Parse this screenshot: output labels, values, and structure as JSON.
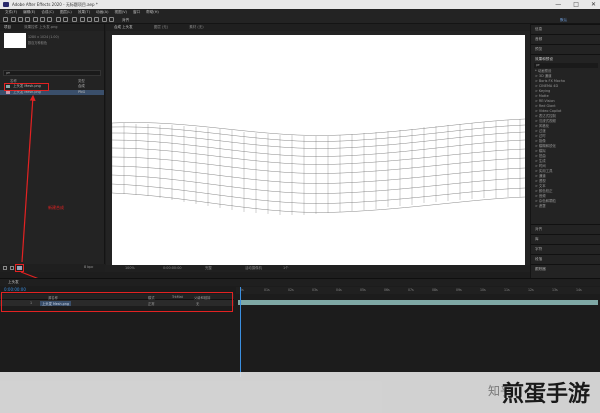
{
  "window": {
    "title": "Adobe After Effects 2020 - 无标题项目.aep *",
    "controls": [
      "—",
      "□",
      "✕"
    ]
  },
  "menu": [
    "文件(F)",
    "编辑(E)",
    "合成(C)",
    "图层(L)",
    "效果(T)",
    "动画(A)",
    "视图(V)",
    "窗口",
    "帮助(H)"
  ],
  "toolbar": {
    "icons": [
      "home-icon",
      "selection-icon",
      "hand-icon",
      "zoom-icon",
      "rotate-icon",
      "camera-icon",
      "pan-behind-icon",
      "rectangle-icon",
      "pen-icon",
      "text-icon",
      "brush-icon",
      "clone-icon",
      "eraser-icon",
      "roto-icon",
      "puppet-icon"
    ],
    "right_label": "对齐",
    "workspace": "默认"
  },
  "project": {
    "tab": "项目",
    "tab2": "效果控件 上头发.png",
    "info_line1": "1280 x 1024 (1.00)",
    "info_line2": "数百万种颜色",
    "search_placeholder": "ρ▾",
    "col_name": "名称",
    "col_type": "类型",
    "items": [
      {
        "name": "上头发 Mesh.png",
        "type": "合成"
      },
      {
        "name": "上头发 Mesh.png",
        "type": "PNG"
      }
    ],
    "bit_depth": "8 bpc"
  },
  "viewer": {
    "tab1": "合成 上头发",
    "tab2": "图层 (无)",
    "tab3": "素材 (无)",
    "zoom": "100%",
    "timecode": "0:00:00:00",
    "resolution": "完整",
    "camera": "活动摄像机",
    "views": "1个"
  },
  "annotation": {
    "text": "新建合成"
  },
  "rightpanel": {
    "sections": [
      "信息",
      "音频",
      "预览",
      "效果和预设"
    ],
    "search": "ρ▾",
    "presets": [
      "* 动画预设",
      "> 3D 通道",
      "> Boris FX Mocha",
      "> CINEMA 4D",
      "> Keying",
      "> Matte",
      "> RE:Vision",
      "> Red Giant",
      "> Video Copilot",
      "> 表达式控制",
      "> 沉浸式视频",
      "> 风格化",
      "> 过渡",
      "> 过时",
      "> 抠像",
      "> 模糊和锐化",
      "> 模拟",
      "> 扭曲",
      "> 生成",
      "> 时间",
      "> 实用工具",
      "> 通道",
      "> 透视",
      "> 文本",
      "> 颜色校正",
      "> 音频",
      "> 杂色和颗粒",
      "> 遮罩"
    ],
    "bottom_sections": [
      "对齐",
      "库",
      "字符",
      "段落",
      "跟踪器"
    ]
  },
  "timeline": {
    "tab": "上头发",
    "timecode": "0:00:00:00",
    "col_source": "源名称",
    "col_mode": "模式",
    "col_trkmat": "TrkMat",
    "col_parent": "父级和链接",
    "layer_index": "1",
    "layer_name": "上头发 Mesh.png",
    "layer_mode": "正常",
    "layer_parent": "无",
    "ruler_marks": [
      "0s",
      "01s",
      "02s",
      "03s",
      "04s",
      "05s",
      "06s",
      "07s",
      "08s",
      "09s",
      "10s",
      "11s",
      "12s",
      "13s",
      "14s"
    ],
    "footer": "切换开关/模式"
  },
  "watermark": {
    "small": "知乎",
    "large": "煎蛋手游"
  },
  "colors": {
    "accent_red": "#e32222",
    "timeline_bar": "#7fa8a5",
    "bg": "#1d1d1d"
  }
}
